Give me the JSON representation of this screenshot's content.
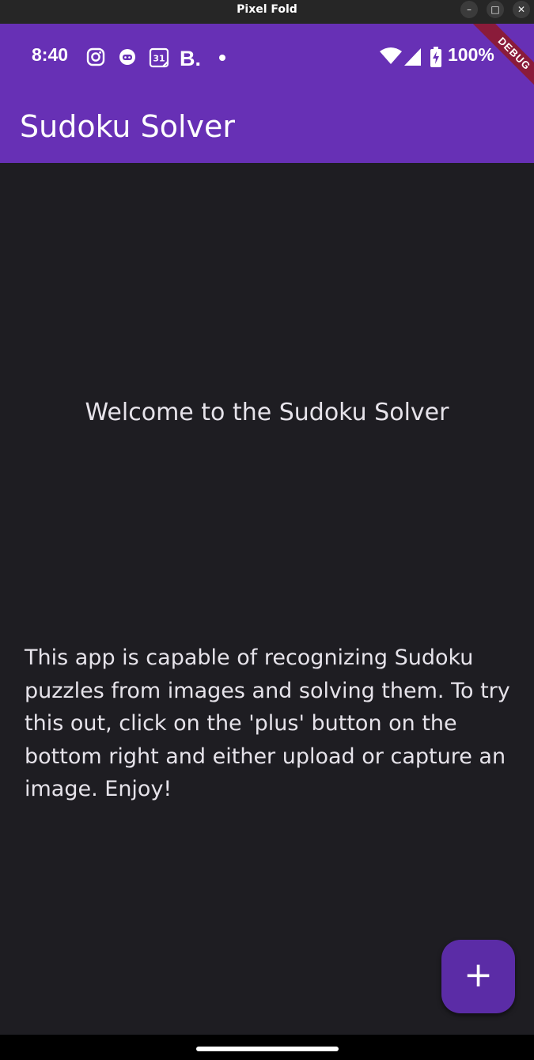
{
  "window": {
    "title": "Pixel Fold",
    "minimize": "–",
    "maximize": "□",
    "close": "✕"
  },
  "status_bar": {
    "time": "8:40",
    "battery": "100%",
    "debug_banner": "DEBUG",
    "icons": [
      "instagram-icon",
      "bot-icon",
      "calendar-icon",
      "b-app-icon",
      "dot-icon",
      "wifi-icon",
      "signal-icon",
      "battery-charging-icon"
    ],
    "calendar_day": "31",
    "b_app_letter": "B."
  },
  "app_bar": {
    "title": "Sudoku Solver"
  },
  "content": {
    "welcome": "Welcome to the Sudoku Solver",
    "description": "This app is capable of recognizing Sudoku puzzles from images and solving them. To try this out, click on the 'plus' button on the bottom right and either upload or capture an image. Enjoy!"
  },
  "fab": {
    "label": "+"
  },
  "colors": {
    "primary": "#6730b5",
    "background": "#1e1d22",
    "fab": "#5b2ca6",
    "text": "#e6e3ea"
  }
}
